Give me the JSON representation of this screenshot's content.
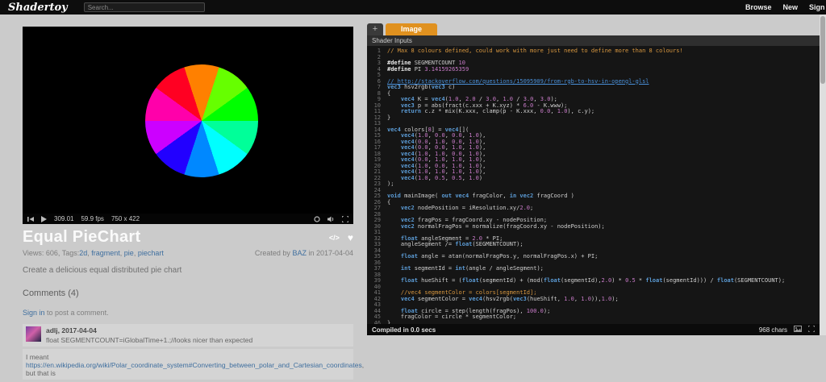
{
  "topbar": {
    "logo": "Shadertoy",
    "search_placeholder": "Search...",
    "nav": {
      "browse": "Browse",
      "new": "New",
      "signin": "Sign in"
    }
  },
  "icons": {
    "heart": "♥",
    "embed": "</>"
  },
  "player": {
    "time": "309.01",
    "fps": "59.9 fps",
    "resolution": "750 x 422"
  },
  "shader": {
    "title": "Equal PieChart",
    "views_label": "Views: 606, Tags: ",
    "tags": [
      "2d",
      "fragment",
      "pie",
      "piechart"
    ],
    "created_prefix": "Created by ",
    "author": "BAZ",
    "created_suffix": " in 2017-04-04",
    "description": "Create a delicious equal distributed pie chart",
    "comments_header": "Comments (4)",
    "signin_link": "Sign in",
    "signin_rest": " to post a comment.",
    "comments": {
      "first": {
        "author": "adlj, 2017-04-04",
        "text": "float SEGMENTCOUNT=iGlobalTime+1.;//looks nicer than expected"
      },
      "second": {
        "text_before": "I meant ",
        "link": "https://en.wikipedia.org/wiki/Polar_coordinate_system#Converting_between_polar_and_Cartesian_coordinates",
        "text_after": ", but that is"
      }
    }
  },
  "chart": {
    "type": "pie",
    "start_angle": -18,
    "colors": [
      "#ff8000",
      "#66ff00",
      "#00ff00",
      "#00ff99",
      "#00ffff",
      "#0088ff",
      "#2200ff",
      "#cc00ff",
      "#ff00aa",
      "#ff0022"
    ]
  },
  "editor": {
    "tab_add": "+",
    "tab_image": "Image",
    "inputs_label": "Shader Inputs",
    "status_compiled": "Compiled in 0.0 secs",
    "status_chars": "968 chars",
    "code_lines": [
      [
        [
          "c",
          "// Max 8 colours defined, could work with more just need to define more than 8 colours!"
        ]
      ],
      [],
      [
        [
          "d",
          "#define "
        ],
        [
          "t",
          "SEGMENTCOUNT "
        ],
        [
          "n",
          "10"
        ]
      ],
      [
        [
          "d",
          "#define "
        ],
        [
          "t",
          "PI "
        ],
        [
          "n",
          "3.14159265359"
        ]
      ],
      [],
      [
        [
          "l",
          "// http://stackoverflow.com/questions/15095909/from-rgb-to-hsv-in-opengl-glsl"
        ]
      ],
      [
        [
          "k",
          "vec3"
        ],
        [
          "t",
          " hsv2rgb("
        ],
        [
          "k",
          "vec3"
        ],
        [
          "t",
          " c)"
        ]
      ],
      [
        [
          "t",
          "{"
        ]
      ],
      [
        [
          "t",
          "    "
        ],
        [
          "k",
          "vec4"
        ],
        [
          "t",
          " K = "
        ],
        [
          "k",
          "vec4"
        ],
        [
          "t",
          "("
        ],
        [
          "n",
          "1.0"
        ],
        [
          "t",
          ", "
        ],
        [
          "n",
          "2.0"
        ],
        [
          "t",
          " / "
        ],
        [
          "n",
          "3.0"
        ],
        [
          "t",
          ", "
        ],
        [
          "n",
          "1.0"
        ],
        [
          "t",
          " / "
        ],
        [
          "n",
          "3.0"
        ],
        [
          "t",
          ", "
        ],
        [
          "n",
          "3.0"
        ],
        [
          "t",
          ");"
        ]
      ],
      [
        [
          "t",
          "    "
        ],
        [
          "k",
          "vec3"
        ],
        [
          "t",
          " p = abs(fract(c.xxx + K.xyz) * "
        ],
        [
          "n",
          "6.0"
        ],
        [
          "t",
          " - K.www);"
        ]
      ],
      [
        [
          "t",
          "    "
        ],
        [
          "k",
          "return"
        ],
        [
          "t",
          " c.z * mix(K.xxx, clamp(p - K.xxx, "
        ],
        [
          "n",
          "0.0"
        ],
        [
          "t",
          ", "
        ],
        [
          "n",
          "1.0"
        ],
        [
          "t",
          "), c.y);"
        ]
      ],
      [
        [
          "t",
          "}"
        ]
      ],
      [],
      [
        [
          "k",
          "vec4"
        ],
        [
          "t",
          " colors["
        ],
        [
          "n",
          "8"
        ],
        [
          "t",
          "] = "
        ],
        [
          "k",
          "vec4"
        ],
        [
          "t",
          "[]("
        ]
      ],
      [
        [
          "t",
          "    "
        ],
        [
          "k",
          "vec4"
        ],
        [
          "t",
          "("
        ],
        [
          "n",
          "1.0"
        ],
        [
          "t",
          ", "
        ],
        [
          "n",
          "0.0"
        ],
        [
          "t",
          ", "
        ],
        [
          "n",
          "0.0"
        ],
        [
          "t",
          ", "
        ],
        [
          "n",
          "1.0"
        ],
        [
          "t",
          "),"
        ]
      ],
      [
        [
          "t",
          "    "
        ],
        [
          "k",
          "vec4"
        ],
        [
          "t",
          "("
        ],
        [
          "n",
          "0.0"
        ],
        [
          "t",
          ", "
        ],
        [
          "n",
          "1.0"
        ],
        [
          "t",
          ", "
        ],
        [
          "n",
          "0.0"
        ],
        [
          "t",
          ", "
        ],
        [
          "n",
          "1.0"
        ],
        [
          "t",
          "),"
        ]
      ],
      [
        [
          "t",
          "    "
        ],
        [
          "k",
          "vec4"
        ],
        [
          "t",
          "("
        ],
        [
          "n",
          "0.0"
        ],
        [
          "t",
          ", "
        ],
        [
          "n",
          "0.0"
        ],
        [
          "t",
          ", "
        ],
        [
          "n",
          "1.0"
        ],
        [
          "t",
          ", "
        ],
        [
          "n",
          "1.0"
        ],
        [
          "t",
          "),"
        ]
      ],
      [
        [
          "t",
          "    "
        ],
        [
          "k",
          "vec4"
        ],
        [
          "t",
          "("
        ],
        [
          "n",
          "1.0"
        ],
        [
          "t",
          ", "
        ],
        [
          "n",
          "1.0"
        ],
        [
          "t",
          ", "
        ],
        [
          "n",
          "0.0"
        ],
        [
          "t",
          ", "
        ],
        [
          "n",
          "1.0"
        ],
        [
          "t",
          "),"
        ]
      ],
      [
        [
          "t",
          "    "
        ],
        [
          "k",
          "vec4"
        ],
        [
          "t",
          "("
        ],
        [
          "n",
          "0.0"
        ],
        [
          "t",
          ", "
        ],
        [
          "n",
          "1.0"
        ],
        [
          "t",
          ", "
        ],
        [
          "n",
          "1.0"
        ],
        [
          "t",
          ", "
        ],
        [
          "n",
          "1.0"
        ],
        [
          "t",
          "),"
        ]
      ],
      [
        [
          "t",
          "    "
        ],
        [
          "k",
          "vec4"
        ],
        [
          "t",
          "("
        ],
        [
          "n",
          "1.0"
        ],
        [
          "t",
          ", "
        ],
        [
          "n",
          "0.0"
        ],
        [
          "t",
          ", "
        ],
        [
          "n",
          "1.0"
        ],
        [
          "t",
          ", "
        ],
        [
          "n",
          "1.0"
        ],
        [
          "t",
          "),"
        ]
      ],
      [
        [
          "t",
          "    "
        ],
        [
          "k",
          "vec4"
        ],
        [
          "t",
          "("
        ],
        [
          "n",
          "1.0"
        ],
        [
          "t",
          ", "
        ],
        [
          "n",
          "1.0"
        ],
        [
          "t",
          ", "
        ],
        [
          "n",
          "1.0"
        ],
        [
          "t",
          ", "
        ],
        [
          "n",
          "1.0"
        ],
        [
          "t",
          "),"
        ]
      ],
      [
        [
          "t",
          "    "
        ],
        [
          "k",
          "vec4"
        ],
        [
          "t",
          "("
        ],
        [
          "n",
          "1.0"
        ],
        [
          "t",
          ", "
        ],
        [
          "n",
          "0.5"
        ],
        [
          "t",
          ", "
        ],
        [
          "n",
          "0.5"
        ],
        [
          "t",
          ", "
        ],
        [
          "n",
          "1.0"
        ],
        [
          "t",
          ")"
        ]
      ],
      [
        [
          "t",
          ");"
        ]
      ],
      [],
      [
        [
          "k",
          "void"
        ],
        [
          "t",
          " mainImage( "
        ],
        [
          "k",
          "out"
        ],
        [
          "t",
          " "
        ],
        [
          "k",
          "vec4"
        ],
        [
          "t",
          " fragColor, "
        ],
        [
          "k",
          "in"
        ],
        [
          "t",
          " "
        ],
        [
          "k",
          "vec2"
        ],
        [
          "t",
          " fragCoord )"
        ]
      ],
      [
        [
          "t",
          "{"
        ]
      ],
      [
        [
          "t",
          "    "
        ],
        [
          "k",
          "vec2"
        ],
        [
          "t",
          " nodePosition = iResolution.xy/"
        ],
        [
          "n",
          "2.0"
        ],
        [
          "t",
          ";"
        ]
      ],
      [],
      [
        [
          "t",
          "    "
        ],
        [
          "k",
          "vec2"
        ],
        [
          "t",
          " fragPos = fragCoord.xy - nodePosition;"
        ]
      ],
      [
        [
          "t",
          "    "
        ],
        [
          "k",
          "vec2"
        ],
        [
          "t",
          " normalFragPos = normalize(fragCoord.xy - nodePosition);"
        ]
      ],
      [],
      [
        [
          "t",
          "    "
        ],
        [
          "k",
          "float"
        ],
        [
          "t",
          " angleSegment = "
        ],
        [
          "n",
          "2.0"
        ],
        [
          "t",
          " * PI;"
        ]
      ],
      [
        [
          "t",
          "    angleSegment /= "
        ],
        [
          "k",
          "float"
        ],
        [
          "t",
          "(SEGMENTCOUNT);"
        ]
      ],
      [],
      [
        [
          "t",
          "    "
        ],
        [
          "k",
          "float"
        ],
        [
          "t",
          " angle = atan(normalFragPos.y, normalFragPos.x) + PI;"
        ]
      ],
      [],
      [
        [
          "t",
          "    "
        ],
        [
          "k",
          "int"
        ],
        [
          "t",
          " segmentId = "
        ],
        [
          "k",
          "int"
        ],
        [
          "t",
          "(angle / angleSegment);"
        ]
      ],
      [],
      [
        [
          "t",
          "    "
        ],
        [
          "k",
          "float"
        ],
        [
          "t",
          " hueShift = ("
        ],
        [
          "k",
          "float"
        ],
        [
          "t",
          "(segmentId) + (mod("
        ],
        [
          "k",
          "float"
        ],
        [
          "t",
          "(segmentId),"
        ],
        [
          "n",
          "2.0"
        ],
        [
          "t",
          ") * "
        ],
        [
          "n",
          "0.5"
        ],
        [
          "t",
          " * "
        ],
        [
          "k",
          "float"
        ],
        [
          "t",
          "(segmentId))) / "
        ],
        [
          "k",
          "float"
        ],
        [
          "t",
          "(SEGMENTCOUNT);"
        ]
      ],
      [],
      [
        [
          "t",
          "    "
        ],
        [
          "c",
          "//vec4 segmentColor = colors[segmentId];"
        ]
      ],
      [
        [
          "t",
          "    "
        ],
        [
          "k",
          "vec4"
        ],
        [
          "t",
          " segmentColor = "
        ],
        [
          "k",
          "vec4"
        ],
        [
          "t",
          "(hsv2rgb("
        ],
        [
          "k",
          "vec3"
        ],
        [
          "t",
          "(hueShift, "
        ],
        [
          "n",
          "1.0"
        ],
        [
          "t",
          ", "
        ],
        [
          "n",
          "1.0"
        ],
        [
          "t",
          ")),"
        ],
        [
          "n",
          "1.0"
        ],
        [
          "t",
          ");"
        ]
      ],
      [],
      [
        [
          "t",
          "    "
        ],
        [
          "k",
          "float"
        ],
        [
          "t",
          " circle = step(length(fragPos), "
        ],
        [
          "n",
          "100.0"
        ],
        [
          "t",
          ");"
        ]
      ],
      [
        [
          "t",
          "    fragColor = circle * segmentColor;"
        ]
      ],
      [
        [
          "t",
          "}"
        ]
      ]
    ]
  }
}
